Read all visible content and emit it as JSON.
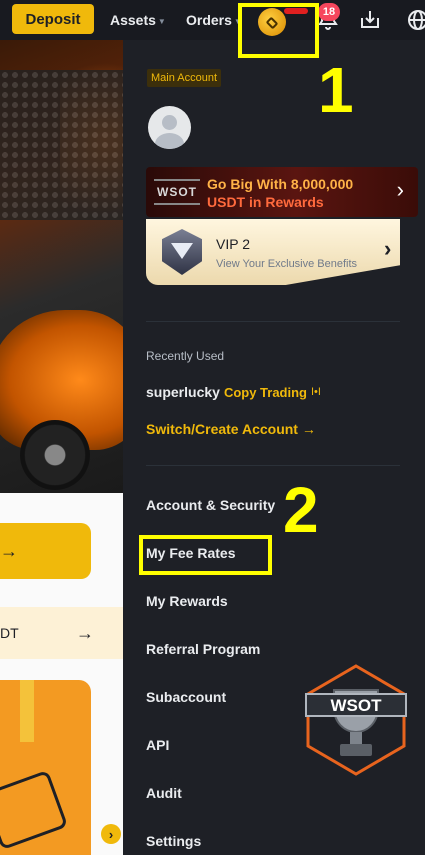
{
  "topbar": {
    "deposit_label": "Deposit",
    "assets_label": "Assets",
    "orders_label": "Orders",
    "notification_count": "18",
    "icons": [
      "user-avatar-icon",
      "bell-icon",
      "download-icon",
      "globe-icon"
    ]
  },
  "annotations": {
    "marker_1": "1",
    "marker_2": "2",
    "highlight_color": "#ffff00"
  },
  "background_page": {
    "row_text": "DT",
    "row_arrow": "→",
    "button_arrow": "→",
    "carousel_arrow": "›"
  },
  "panel": {
    "account_tag": "Main Account",
    "promo": {
      "logo": "WSOT",
      "line1": "Go Big With 8,000,000",
      "line2": "USDT in Rewards"
    },
    "vip": {
      "title": "VIP 2",
      "subtitle": "View Your Exclusive Benefits"
    },
    "recently_used_label": "Recently Used",
    "recent_account": {
      "name": "superlucky",
      "tag": "Copy Trading",
      "tag_icon": "I•I"
    },
    "switch_link": "Switch/Create Account →",
    "menu": [
      "Account & Security",
      "My Fee Rates",
      "My Rewards",
      "Referral Program",
      "Subaccount",
      "API",
      "Audit",
      "Settings"
    ],
    "badge_logo": "WSOT"
  },
  "colors": {
    "brand_yellow": "#f0b90b",
    "panel_bg": "#1e2026",
    "topbar_bg": "#181a20",
    "badge_red": "#f6465d"
  }
}
